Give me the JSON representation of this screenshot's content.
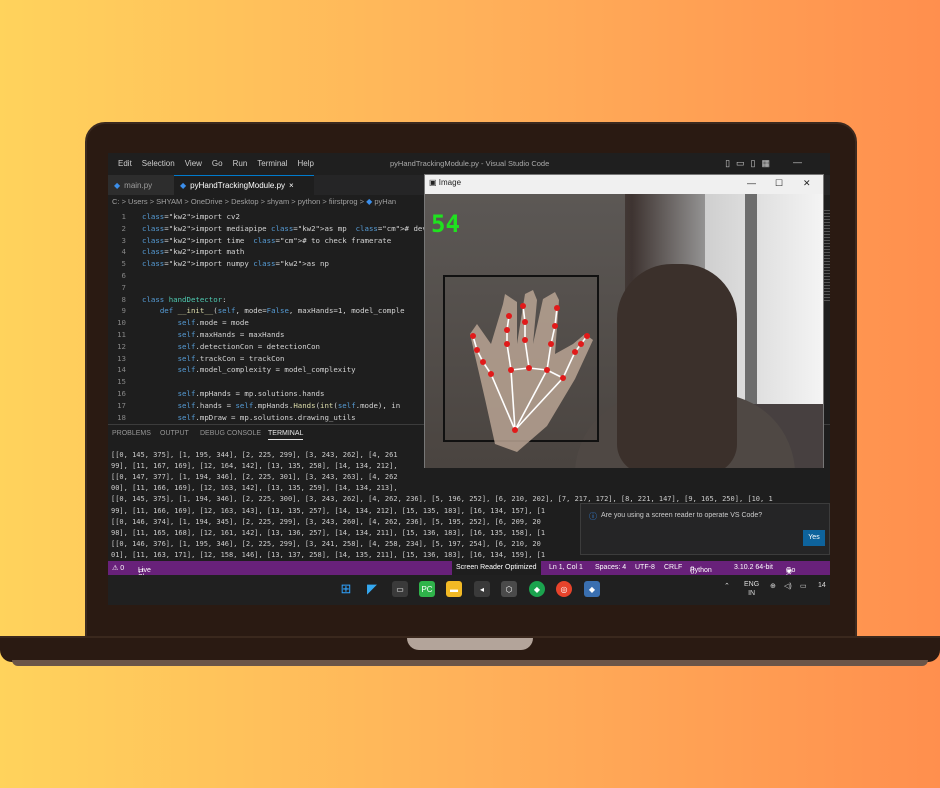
{
  "vscode": {
    "menu": [
      "Edit",
      "Selection",
      "View",
      "Go",
      "Run",
      "Terminal",
      "Help"
    ],
    "window_title": "pyHandTrackingModule.py - Visual Studio Code",
    "tabs": [
      {
        "label": "main.py"
      },
      {
        "label": "pyHandTrackingModule.py",
        "close": "×"
      }
    ],
    "breadcrumb": "C: > Users > SHYAM > OneDrive > Desktop > shyam > python > fiirstprog > ",
    "breadcrumb_tail": "pyHan",
    "code_lines": [
      {
        "n": "1",
        "t": "import cv2"
      },
      {
        "n": "2",
        "t": "import mediapipe as mp  # developed by google"
      },
      {
        "n": "3",
        "t": "import time  # to check framerate"
      },
      {
        "n": "4",
        "t": "import math"
      },
      {
        "n": "5",
        "t": "import numpy as np"
      },
      {
        "n": "6",
        "t": ""
      },
      {
        "n": "7",
        "t": ""
      },
      {
        "n": "8",
        "t": "class handDetector:"
      },
      {
        "n": "9",
        "t": "    def __init__(self, mode=False, maxHands=1, model_comple"
      },
      {
        "n": "10",
        "t": "        self.mode = mode"
      },
      {
        "n": "11",
        "t": "        self.maxHands = maxHands"
      },
      {
        "n": "12",
        "t": "        self.detectionCon = detectionCon"
      },
      {
        "n": "13",
        "t": "        self.trackCon = trackCon"
      },
      {
        "n": "14",
        "t": "        self.model_complexity = model_complexity"
      },
      {
        "n": "15",
        "t": ""
      },
      {
        "n": "16",
        "t": "        self.mpHands = mp.solutions.hands"
      },
      {
        "n": "17",
        "t": "        self.hands = self.mpHands.Hands(int(self.mode), in"
      },
      {
        "n": "18",
        "t": "        self.mpDraw = mp.solutions.drawing_utils"
      }
    ],
    "panel_tabs": [
      "PROBLEMS",
      "OUTPUT",
      "DEBUG CONSOLE",
      "TERMINAL"
    ],
    "terminal_lines": [
      "[[0, 145, 375], [1, 195, 344], [2, 225, 299], [3, 243, 262], [4, 261",
      "99], [11, 167, 169], [12, 164, 142], [13, 135, 258], [14, 134, 212],",
      "[[0, 147, 377], [1, 194, 346], [2, 225, 301], [3, 243, 263], [4, 262",
      "00], [11, 166, 169], [12, 163, 142], [13, 135, 259], [14, 134, 213],",
      "[[0, 145, 375], [1, 194, 346], [2, 225, 300], [3, 243, 262], [4, 262, 236], [5, 196, 252], [6, 210, 202], [7, 217, 172], [8, 221, 147], [9, 165, 250], [10, 1",
      "99], [11, 166, 169], [12, 163, 143], [13, 135, 257], [14, 134, 212], [15, 135, 183], [16, 134, 157], [1",
      "[[0, 146, 374], [1, 194, 345], [2, 225, 299], [3, 243, 260], [4, 262, 236], [5, 195, 252], [6, 209, 20",
      "98], [11, 165, 168], [12, 161, 142], [13, 136, 257], [14, 134, 211], [15, 136, 183], [16, 135, 158], [1",
      "[[0, 146, 376], [1, 195, 346], [2, 225, 299], [3, 241, 258], [4, 258, 234], [5, 197, 254], [6, 210, 20",
      "01], [11, 163, 171], [12, 158, 146], [13, 137, 258], [14, 135, 211], [15, 136, 183], [16, 134, 159], [1"
    ],
    "notification": {
      "message": "Are you using a screen reader to operate VS Code?",
      "yes": "Yes"
    },
    "status": {
      "left_count": "⚠ 0",
      "live_share": "Live Share",
      "sro": "Screen Reader Optimized",
      "ln": "Ln 1, Col 1",
      "spaces": "Spaces: 4",
      "encoding": "UTF-8",
      "eol": "CRLF",
      "language": "Python",
      "interpreter": "3.10.2 64-bit",
      "golive": "Go Live"
    },
    "taskbar": {
      "lang1": "ENG",
      "lang2": "IN",
      "time": "14"
    }
  },
  "image_window": {
    "title": "Image",
    "fps": "54",
    "landmark_color": "#e11a1a",
    "bone_color": "#ffffff",
    "fps_color": "#1fe21f"
  }
}
